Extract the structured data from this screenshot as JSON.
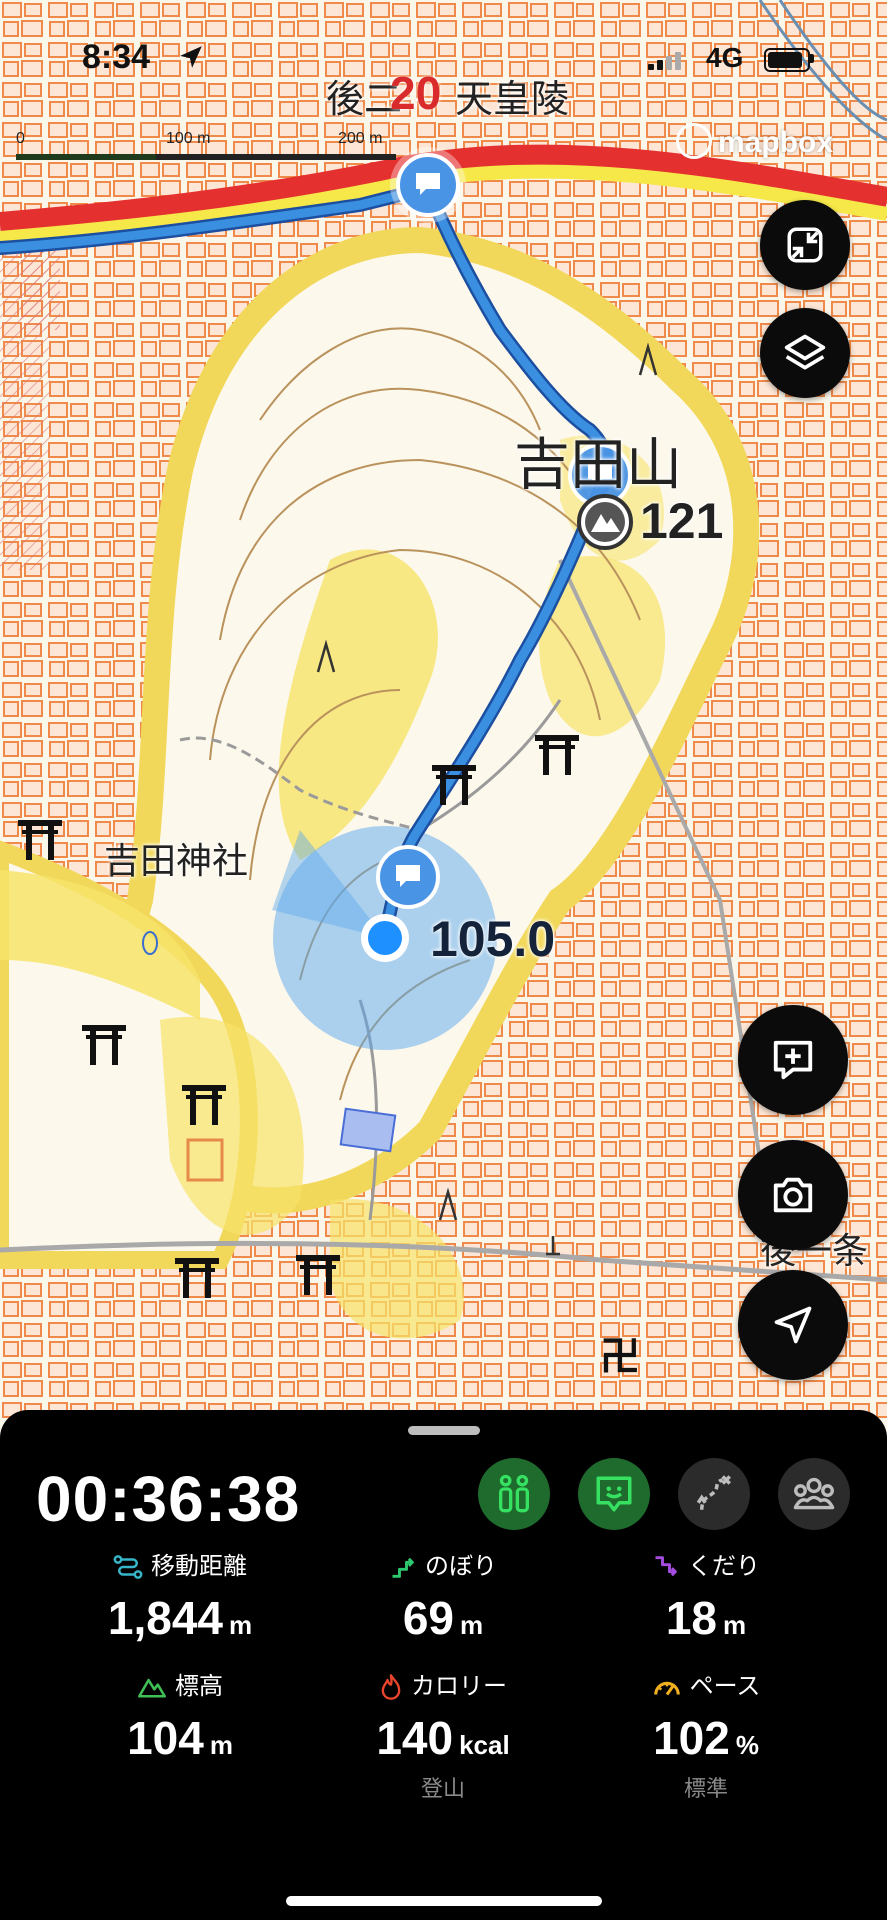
{
  "status_bar": {
    "time": "8:34",
    "network": "4G"
  },
  "map": {
    "zoom_level": "20",
    "attribution": "mapbox",
    "scale": {
      "ticks": [
        "0",
        "100 m",
        "200 m"
      ]
    },
    "labels": {
      "top_label": "後二",
      "top_label_end": "天皇陵",
      "mountain_name": "吉田山",
      "peak_elevation": "121",
      "shrine_name": "吉田神社",
      "current_elevation": "105.0",
      "right_edge_label": "後一条"
    }
  },
  "side_buttons": [
    "fit-route",
    "layers"
  ],
  "action_buttons": [
    "add-memo",
    "camera",
    "locate"
  ],
  "panel": {
    "elapsed": "00:36:38",
    "modes": [
      "hiking",
      "active-tracking",
      "route",
      "group"
    ],
    "stats": [
      {
        "label": "移動距離",
        "value": "1,844",
        "unit": "m",
        "sub": "",
        "color": "#36b6c8",
        "icon": "distance-icon"
      },
      {
        "label": "のぼり",
        "value": "69",
        "unit": "m",
        "sub": "",
        "color": "#2dc76d",
        "icon": "ascent-icon"
      },
      {
        "label": "くだり",
        "value": "18",
        "unit": "m",
        "sub": "",
        "color": "#a54de0",
        "icon": "descent-icon"
      },
      {
        "label": "標高",
        "value": "104",
        "unit": "m",
        "sub": "",
        "color": "#3fbf55",
        "icon": "mountain-icon"
      },
      {
        "label": "カロリー",
        "value": "140",
        "unit": "kcal",
        "sub": "登山",
        "color": "#e8452c",
        "icon": "flame-icon"
      },
      {
        "label": "ペース",
        "value": "102",
        "unit": "%",
        "sub": "標準",
        "color": "#f0b020",
        "icon": "gauge-icon"
      }
    ]
  },
  "colors": {
    "route": "#3a8fe0",
    "road_red": "#e53030",
    "road_yellow": "#f7e84a",
    "building": "#ef8a4a",
    "vegetation": "#f6e46a",
    "accent_green": "#1f9d3a"
  }
}
